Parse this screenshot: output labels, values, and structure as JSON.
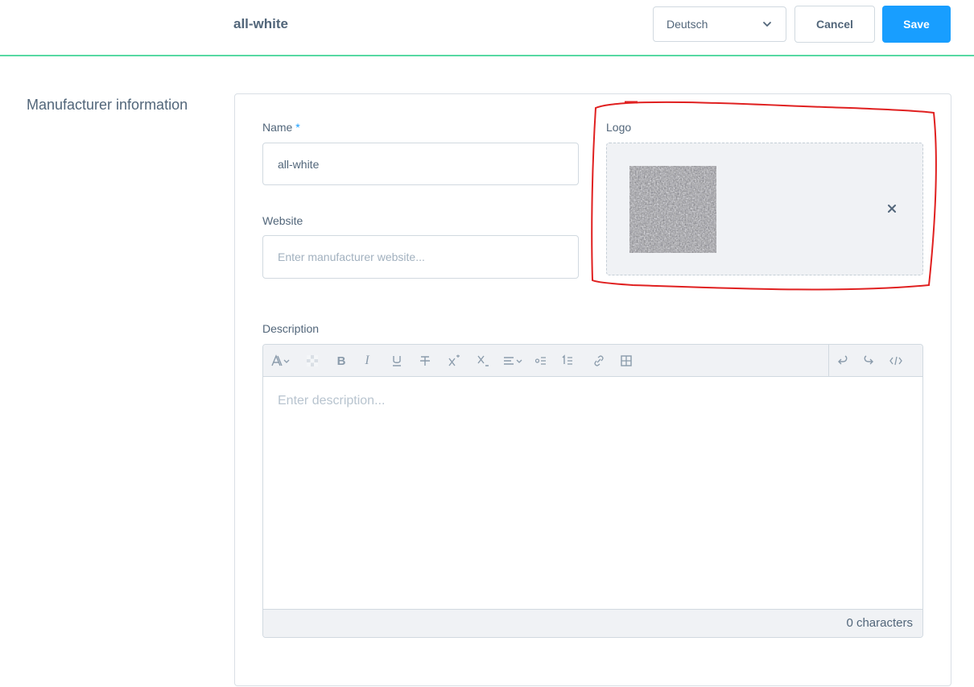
{
  "header": {
    "title": "all-white",
    "language": "Deutsch",
    "cancel_label": "Cancel",
    "save_label": "Save"
  },
  "section": {
    "title": "Manufacturer information"
  },
  "form": {
    "name_label": "Name",
    "name_required_mark": "*",
    "name_value": "all-white",
    "website_label": "Website",
    "website_placeholder": "Enter manufacturer website...",
    "logo_label": "Logo",
    "description_label": "Description",
    "description_placeholder": "Enter description...",
    "char_count": "0 characters"
  },
  "editor_toolbar": {
    "icons": [
      "text-style-icon",
      "text-color-icon",
      "bold-icon",
      "italic-icon",
      "underline-icon",
      "strikethrough-icon",
      "superscript-icon",
      "subscript-icon",
      "align-icon",
      "bullet-list-icon",
      "numbered-list-icon",
      "link-icon",
      "table-icon",
      "undo-icon",
      "redo-icon",
      "code-view-icon"
    ]
  },
  "colors": {
    "accent": "#189eff",
    "header_border": "#57d9a3",
    "annotation": "#e02020",
    "text": "#52667a"
  }
}
